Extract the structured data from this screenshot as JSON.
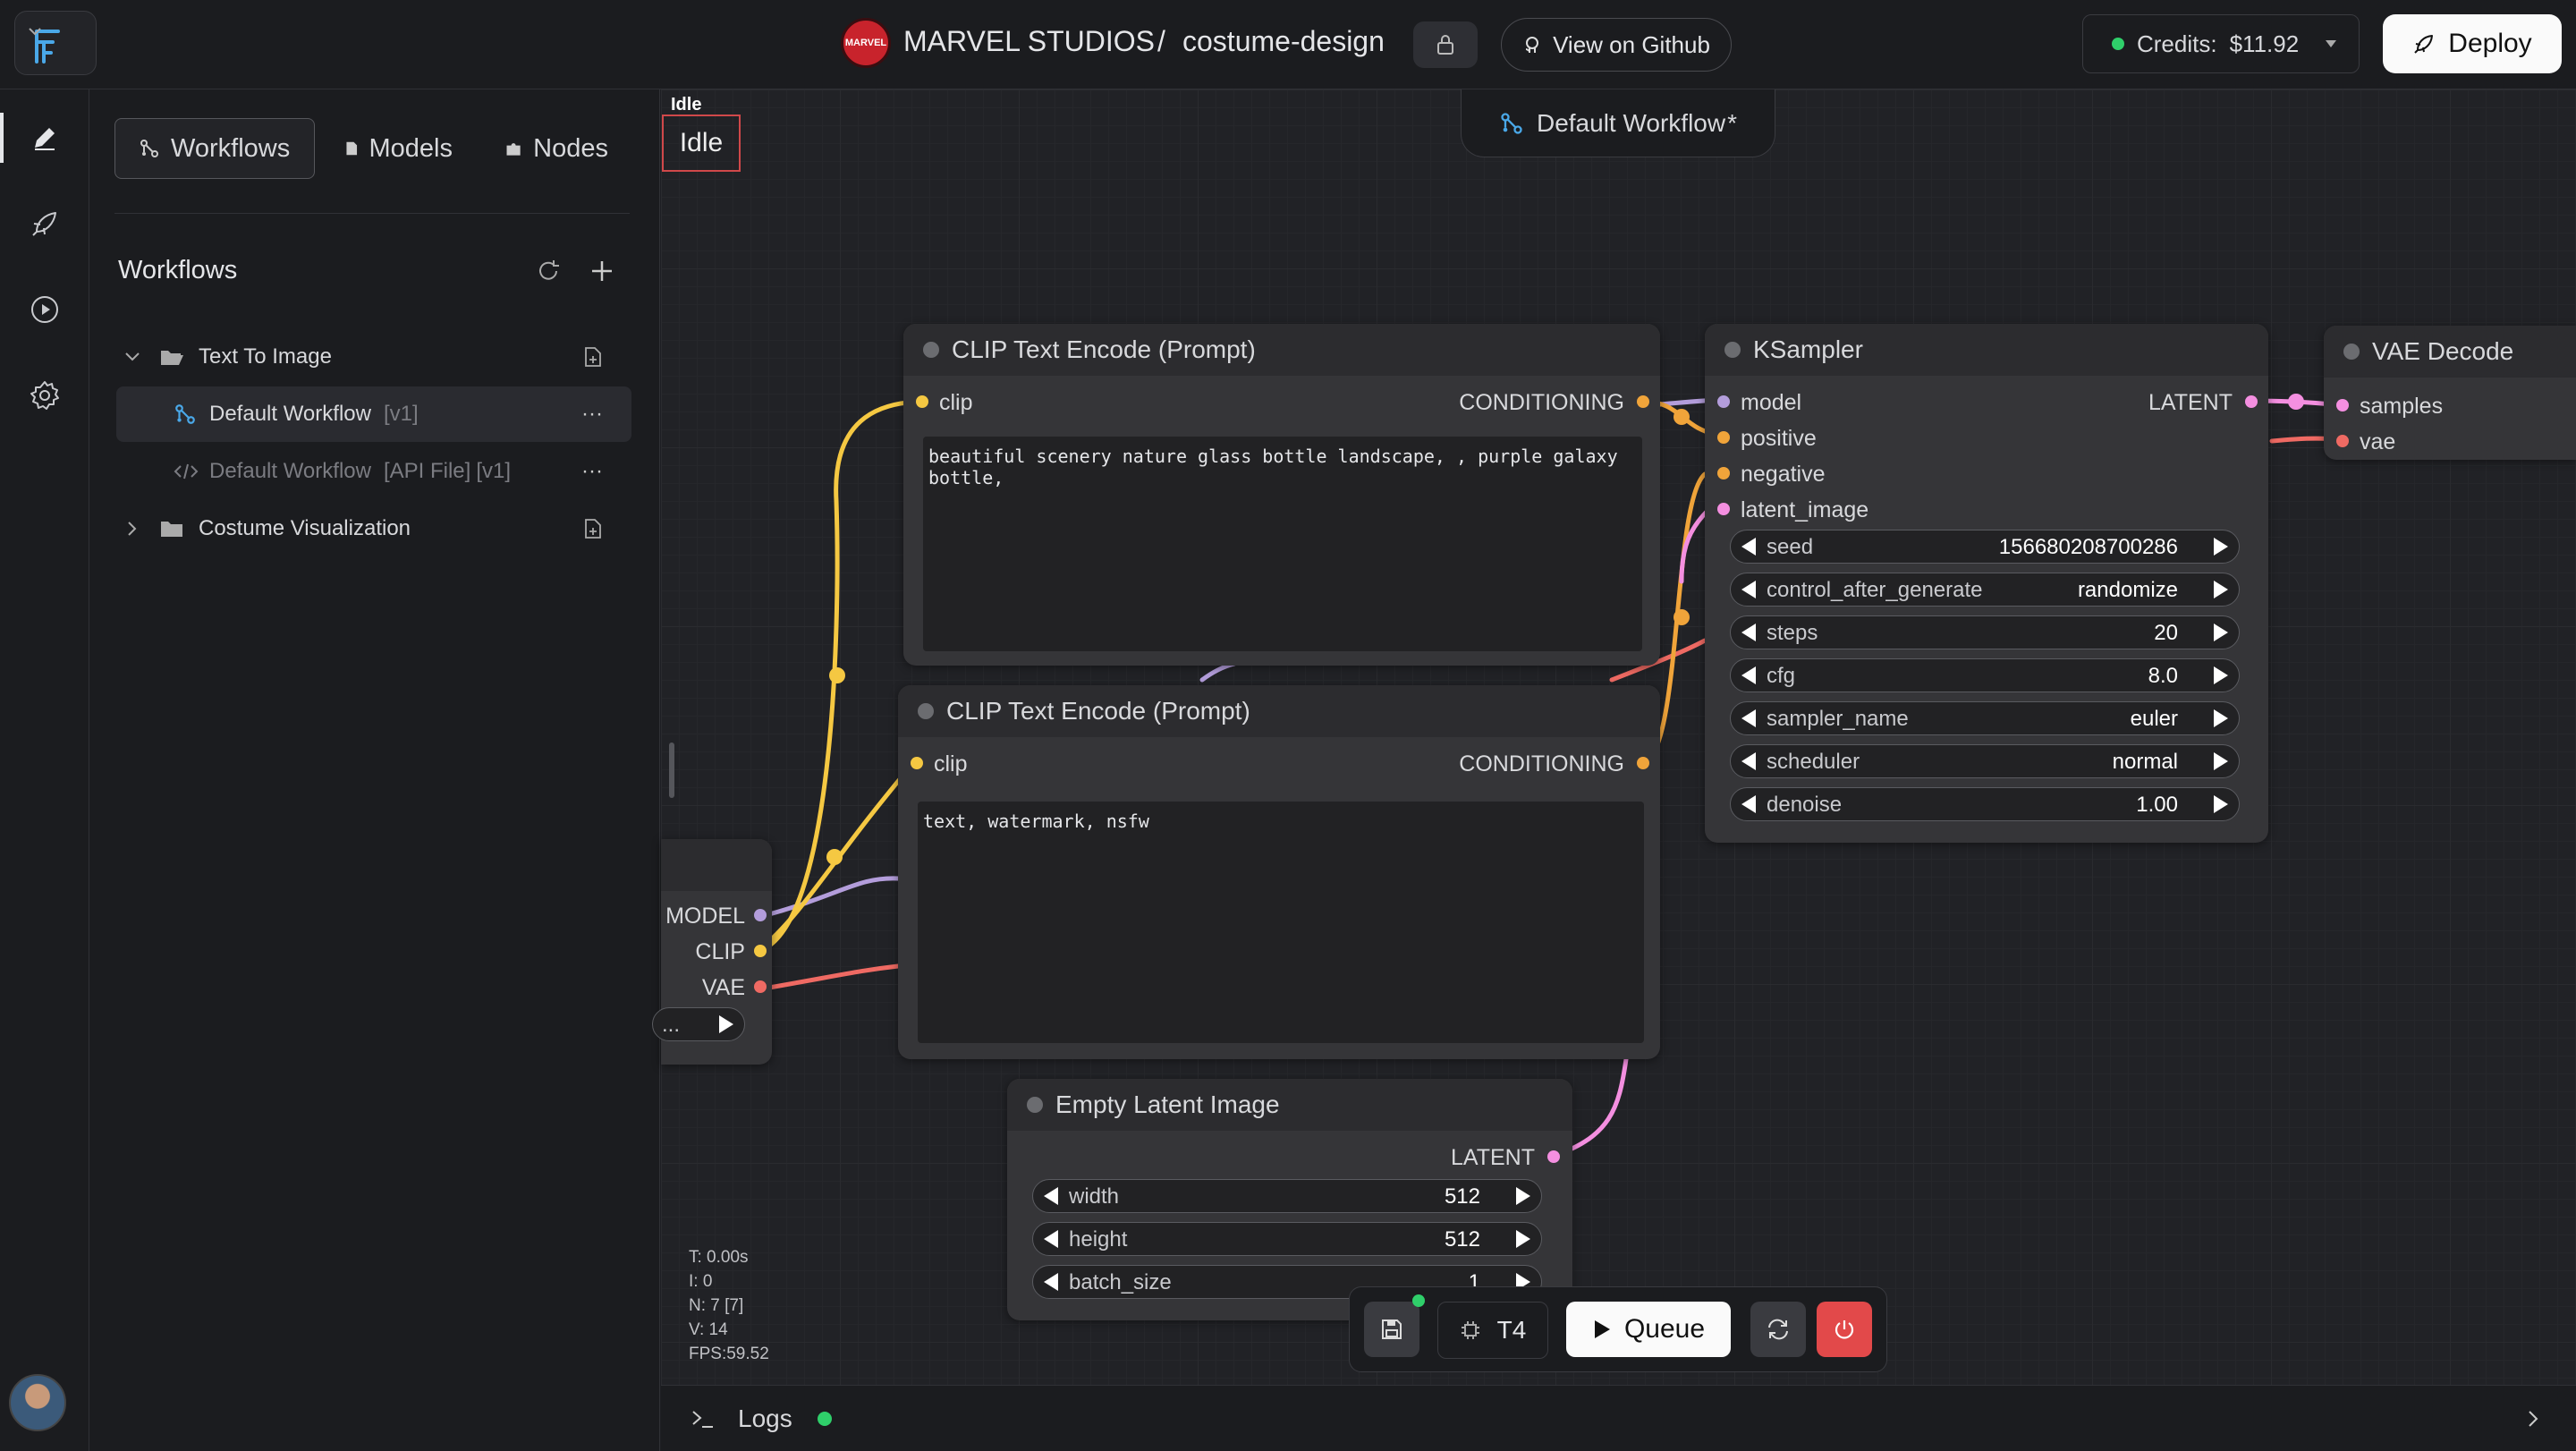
{
  "header": {
    "brand_badge": "MARVEL",
    "org": "MARVEL STUDIOS",
    "separator": "/",
    "project": "costume-design",
    "github_label": "View on Github",
    "credits_label": "Credits:",
    "credits_value": "$11.92",
    "deploy_label": "Deploy"
  },
  "sidebar": {
    "tabs": [
      {
        "label": "Workflows",
        "icon": "workflow-icon",
        "active": true
      },
      {
        "label": "Models",
        "icon": "file-icon"
      },
      {
        "label": "Nodes",
        "icon": "puzzle-icon"
      }
    ],
    "section_title": "Workflows",
    "tree": {
      "folder1": "Text To Image",
      "item1_name": "Default Workflow",
      "item1_version": "[v1]",
      "item2_name": "Default Workflow",
      "item2_tag": "[API File]",
      "item2_version": "[v1]",
      "folder2": "Costume Visualization",
      "more": "···"
    }
  },
  "canvas": {
    "status_small": "Idle",
    "status_box": "Idle",
    "workflow_tab": "Default Workflow",
    "workflow_tab_modified": "*",
    "loader_outputs": [
      "MODEL",
      "CLIP",
      "VAE"
    ],
    "loader_widget": "...",
    "clip1": {
      "title": "CLIP Text Encode (Prompt)",
      "input": "clip",
      "output": "CONDITIONING",
      "text": "beautiful scenery nature glass bottle landscape, , purple galaxy bottle,"
    },
    "clip2": {
      "title": "CLIP Text Encode (Prompt)",
      "input": "clip",
      "output": "CONDITIONING",
      "text": "text, watermark, nsfw"
    },
    "ksampler": {
      "title": "KSampler",
      "inputs": [
        "model",
        "positive",
        "negative",
        "latent_image"
      ],
      "output": "LATENT",
      "widgets": [
        {
          "label": "seed",
          "value": "156680208700286"
        },
        {
          "label": "control_after_generate",
          "value": "randomize"
        },
        {
          "label": "steps",
          "value": "20"
        },
        {
          "label": "cfg",
          "value": "8.0"
        },
        {
          "label": "sampler_name",
          "value": "euler"
        },
        {
          "label": "scheduler",
          "value": "normal"
        },
        {
          "label": "denoise",
          "value": "1.00"
        }
      ]
    },
    "vae": {
      "title": "VAE Decode",
      "inputs": [
        "samples",
        "vae"
      ]
    },
    "latent": {
      "title": "Empty Latent Image",
      "output": "LATENT",
      "widgets": [
        {
          "label": "width",
          "value": "512"
        },
        {
          "label": "height",
          "value": "512"
        },
        {
          "label": "batch_size",
          "value": "1"
        }
      ]
    },
    "stats": [
      "T: 0.00s",
      "I: 0",
      "N: 7 [7]",
      "V: 14",
      "FPS:59.52"
    ],
    "queue": {
      "gpu": "T4",
      "queue_label": "Queue"
    }
  },
  "logs": {
    "label": "Logs"
  },
  "colors": {
    "clip": "#f5c842",
    "model": "#b39ddb",
    "vae": "#ef6a63",
    "latent": "#f48fe0",
    "conditioning": "#f0a43a",
    "danger": "#e2494a",
    "online": "#2fcf6a"
  }
}
